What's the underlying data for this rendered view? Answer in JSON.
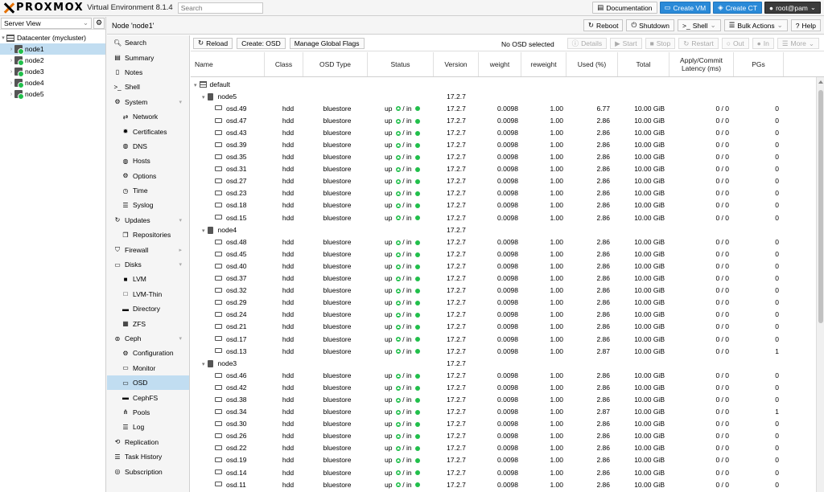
{
  "app": {
    "brand": "PROXMOX",
    "subtitle": "Virtual Environment 8.1.4",
    "search_placeholder": "Search"
  },
  "top_buttons": {
    "documentation": "Documentation",
    "create_vm": "Create VM",
    "create_ct": "Create CT",
    "user": "root@pam"
  },
  "tree": {
    "view_select": "Server View",
    "datacenter": "Datacenter (mycluster)",
    "nodes": [
      "node1",
      "node2",
      "node3",
      "node4",
      "node5"
    ]
  },
  "nodebar": {
    "title": "Node 'node1'",
    "reboot": "Reboot",
    "shutdown": "Shutdown",
    "shell": "Shell",
    "bulk": "Bulk Actions",
    "help": "Help"
  },
  "menu": {
    "search": "Search",
    "summary": "Summary",
    "notes": "Notes",
    "shell": "Shell",
    "system": "System",
    "network": "Network",
    "certificates": "Certificates",
    "dns": "DNS",
    "hosts": "Hosts",
    "options": "Options",
    "time": "Time",
    "syslog": "Syslog",
    "updates": "Updates",
    "repositories": "Repositories",
    "firewall": "Firewall",
    "disks": "Disks",
    "lvm": "LVM",
    "lvm_thin": "LVM-Thin",
    "directory": "Directory",
    "zfs": "ZFS",
    "ceph": "Ceph",
    "configuration": "Configuration",
    "monitor": "Monitor",
    "osd": "OSD",
    "cephfs": "CephFS",
    "pools": "Pools",
    "log": "Log",
    "replication": "Replication",
    "task_history": "Task History",
    "subscription": "Subscription"
  },
  "toolbar": {
    "reload": "Reload",
    "create_osd": "Create: OSD",
    "global_flags": "Manage Global Flags",
    "no_osd": "No OSD selected",
    "details": "Details",
    "start": "Start",
    "stop": "Stop",
    "restart": "Restart",
    "out": "Out",
    "in": "In",
    "more": "More"
  },
  "columns": {
    "name": "Name",
    "class": "Class",
    "osd_type": "OSD Type",
    "status": "Status",
    "version": "Version",
    "weight": "weight",
    "reweight": "reweight",
    "used": "Used (%)",
    "total": "Total",
    "latency": "Apply/Commit Latency (ms)",
    "pgs": "PGs"
  },
  "osd_tree": {
    "root": "default",
    "status_up": "up",
    "status_sep": " / in",
    "hosts": [
      {
        "name": "node5",
        "version": "17.2.7",
        "osds": [
          {
            "name": "osd.49",
            "class": "hdd",
            "type": "bluestore",
            "version": "17.2.7",
            "weight": "0.0098",
            "reweight": "1.00",
            "used": "6.77",
            "total": "10.00 GiB",
            "latency": "0 / 0",
            "pgs": "0"
          },
          {
            "name": "osd.47",
            "class": "hdd",
            "type": "bluestore",
            "version": "17.2.7",
            "weight": "0.0098",
            "reweight": "1.00",
            "used": "2.86",
            "total": "10.00 GiB",
            "latency": "0 / 0",
            "pgs": "0"
          },
          {
            "name": "osd.43",
            "class": "hdd",
            "type": "bluestore",
            "version": "17.2.7",
            "weight": "0.0098",
            "reweight": "1.00",
            "used": "2.86",
            "total": "10.00 GiB",
            "latency": "0 / 0",
            "pgs": "0"
          },
          {
            "name": "osd.39",
            "class": "hdd",
            "type": "bluestore",
            "version": "17.2.7",
            "weight": "0.0098",
            "reweight": "1.00",
            "used": "2.86",
            "total": "10.00 GiB",
            "latency": "0 / 0",
            "pgs": "0"
          },
          {
            "name": "osd.35",
            "class": "hdd",
            "type": "bluestore",
            "version": "17.2.7",
            "weight": "0.0098",
            "reweight": "1.00",
            "used": "2.86",
            "total": "10.00 GiB",
            "latency": "0 / 0",
            "pgs": "0"
          },
          {
            "name": "osd.31",
            "class": "hdd",
            "type": "bluestore",
            "version": "17.2.7",
            "weight": "0.0098",
            "reweight": "1.00",
            "used": "2.86",
            "total": "10.00 GiB",
            "latency": "0 / 0",
            "pgs": "0"
          },
          {
            "name": "osd.27",
            "class": "hdd",
            "type": "bluestore",
            "version": "17.2.7",
            "weight": "0.0098",
            "reweight": "1.00",
            "used": "2.86",
            "total": "10.00 GiB",
            "latency": "0 / 0",
            "pgs": "0"
          },
          {
            "name": "osd.23",
            "class": "hdd",
            "type": "bluestore",
            "version": "17.2.7",
            "weight": "0.0098",
            "reweight": "1.00",
            "used": "2.86",
            "total": "10.00 GiB",
            "latency": "0 / 0",
            "pgs": "0"
          },
          {
            "name": "osd.18",
            "class": "hdd",
            "type": "bluestore",
            "version": "17.2.7",
            "weight": "0.0098",
            "reweight": "1.00",
            "used": "2.86",
            "total": "10.00 GiB",
            "latency": "0 / 0",
            "pgs": "0"
          },
          {
            "name": "osd.15",
            "class": "hdd",
            "type": "bluestore",
            "version": "17.2.7",
            "weight": "0.0098",
            "reweight": "1.00",
            "used": "2.86",
            "total": "10.00 GiB",
            "latency": "0 / 0",
            "pgs": "0"
          }
        ]
      },
      {
        "name": "node4",
        "version": "17.2.7",
        "osds": [
          {
            "name": "osd.48",
            "class": "hdd",
            "type": "bluestore",
            "version": "17.2.7",
            "weight": "0.0098",
            "reweight": "1.00",
            "used": "2.86",
            "total": "10.00 GiB",
            "latency": "0 / 0",
            "pgs": "0"
          },
          {
            "name": "osd.45",
            "class": "hdd",
            "type": "bluestore",
            "version": "17.2.7",
            "weight": "0.0098",
            "reweight": "1.00",
            "used": "2.86",
            "total": "10.00 GiB",
            "latency": "0 / 0",
            "pgs": "0"
          },
          {
            "name": "osd.40",
            "class": "hdd",
            "type": "bluestore",
            "version": "17.2.7",
            "weight": "0.0098",
            "reweight": "1.00",
            "used": "2.86",
            "total": "10.00 GiB",
            "latency": "0 / 0",
            "pgs": "0"
          },
          {
            "name": "osd.37",
            "class": "hdd",
            "type": "bluestore",
            "version": "17.2.7",
            "weight": "0.0098",
            "reweight": "1.00",
            "used": "2.86",
            "total": "10.00 GiB",
            "latency": "0 / 0",
            "pgs": "0"
          },
          {
            "name": "osd.32",
            "class": "hdd",
            "type": "bluestore",
            "version": "17.2.7",
            "weight": "0.0098",
            "reweight": "1.00",
            "used": "2.86",
            "total": "10.00 GiB",
            "latency": "0 / 0",
            "pgs": "0"
          },
          {
            "name": "osd.29",
            "class": "hdd",
            "type": "bluestore",
            "version": "17.2.7",
            "weight": "0.0098",
            "reweight": "1.00",
            "used": "2.86",
            "total": "10.00 GiB",
            "latency": "0 / 0",
            "pgs": "0"
          },
          {
            "name": "osd.24",
            "class": "hdd",
            "type": "bluestore",
            "version": "17.2.7",
            "weight": "0.0098",
            "reweight": "1.00",
            "used": "2.86",
            "total": "10.00 GiB",
            "latency": "0 / 0",
            "pgs": "0"
          },
          {
            "name": "osd.21",
            "class": "hdd",
            "type": "bluestore",
            "version": "17.2.7",
            "weight": "0.0098",
            "reweight": "1.00",
            "used": "2.86",
            "total": "10.00 GiB",
            "latency": "0 / 0",
            "pgs": "0"
          },
          {
            "name": "osd.17",
            "class": "hdd",
            "type": "bluestore",
            "version": "17.2.7",
            "weight": "0.0098",
            "reweight": "1.00",
            "used": "2.86",
            "total": "10.00 GiB",
            "latency": "0 / 0",
            "pgs": "0"
          },
          {
            "name": "osd.13",
            "class": "hdd",
            "type": "bluestore",
            "version": "17.2.7",
            "weight": "0.0098",
            "reweight": "1.00",
            "used": "2.87",
            "total": "10.00 GiB",
            "latency": "0 / 0",
            "pgs": "1"
          }
        ]
      },
      {
        "name": "node3",
        "version": "17.2.7",
        "osds": [
          {
            "name": "osd.46",
            "class": "hdd",
            "type": "bluestore",
            "version": "17.2.7",
            "weight": "0.0098",
            "reweight": "1.00",
            "used": "2.86",
            "total": "10.00 GiB",
            "latency": "0 / 0",
            "pgs": "0"
          },
          {
            "name": "osd.42",
            "class": "hdd",
            "type": "bluestore",
            "version": "17.2.7",
            "weight": "0.0098",
            "reweight": "1.00",
            "used": "2.86",
            "total": "10.00 GiB",
            "latency": "0 / 0",
            "pgs": "0"
          },
          {
            "name": "osd.38",
            "class": "hdd",
            "type": "bluestore",
            "version": "17.2.7",
            "weight": "0.0098",
            "reweight": "1.00",
            "used": "2.86",
            "total": "10.00 GiB",
            "latency": "0 / 0",
            "pgs": "0"
          },
          {
            "name": "osd.34",
            "class": "hdd",
            "type": "bluestore",
            "version": "17.2.7",
            "weight": "0.0098",
            "reweight": "1.00",
            "used": "2.87",
            "total": "10.00 GiB",
            "latency": "0 / 0",
            "pgs": "1"
          },
          {
            "name": "osd.30",
            "class": "hdd",
            "type": "bluestore",
            "version": "17.2.7",
            "weight": "0.0098",
            "reweight": "1.00",
            "used": "2.86",
            "total": "10.00 GiB",
            "latency": "0 / 0",
            "pgs": "0"
          },
          {
            "name": "osd.26",
            "class": "hdd",
            "type": "bluestore",
            "version": "17.2.7",
            "weight": "0.0098",
            "reweight": "1.00",
            "used": "2.86",
            "total": "10.00 GiB",
            "latency": "0 / 0",
            "pgs": "0"
          },
          {
            "name": "osd.22",
            "class": "hdd",
            "type": "bluestore",
            "version": "17.2.7",
            "weight": "0.0098",
            "reweight": "1.00",
            "used": "2.86",
            "total": "10.00 GiB",
            "latency": "0 / 0",
            "pgs": "0"
          },
          {
            "name": "osd.19",
            "class": "hdd",
            "type": "bluestore",
            "version": "17.2.7",
            "weight": "0.0098",
            "reweight": "1.00",
            "used": "2.86",
            "total": "10.00 GiB",
            "latency": "0 / 0",
            "pgs": "0"
          },
          {
            "name": "osd.14",
            "class": "hdd",
            "type": "bluestore",
            "version": "17.2.7",
            "weight": "0.0098",
            "reweight": "1.00",
            "used": "2.86",
            "total": "10.00 GiB",
            "latency": "0 / 0",
            "pgs": "0"
          },
          {
            "name": "osd.11",
            "class": "hdd",
            "type": "bluestore",
            "version": "17.2.7",
            "weight": "0.0098",
            "reweight": "1.00",
            "used": "2.86",
            "total": "10.00 GiB",
            "latency": "0 / 0",
            "pgs": "0"
          }
        ]
      }
    ]
  },
  "colors": {
    "accent": "#2a8ad8",
    "selected": "#c1ddf1",
    "status_ok": "#21bf4b",
    "logo_orange": "#e57000"
  }
}
